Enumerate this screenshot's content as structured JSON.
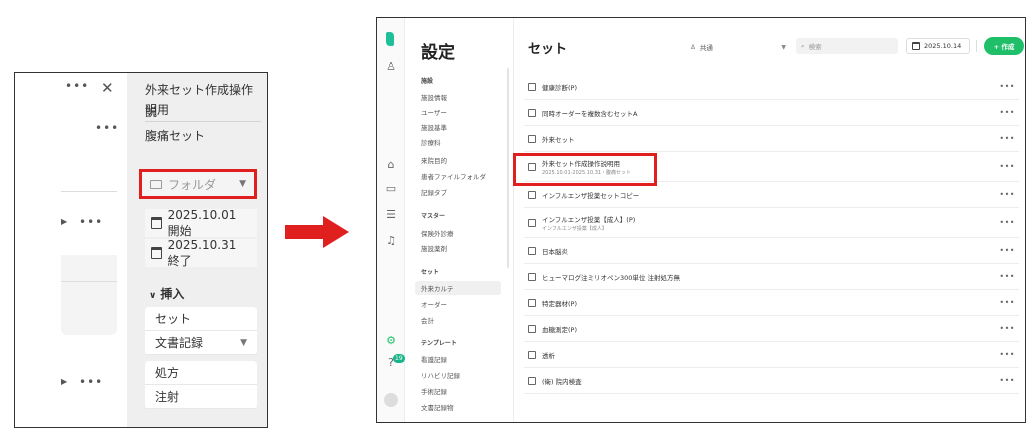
{
  "left_panel": {
    "title_line1": "外来セット作成操作説",
    "title_line2": "明用",
    "subtitle": "腹痛セット",
    "folder_placeholder": "フォルダ",
    "start_date": "2025.10.01 開始",
    "end_date": "2025.10.31 終了",
    "insert_label": "挿入",
    "insert_items": [
      "セット",
      "文書記録"
    ],
    "insert_items2": [
      "処方",
      "注射"
    ]
  },
  "right_panel": {
    "settings_title": "設定",
    "nav": {
      "group1": "施設",
      "group1_items": [
        "施設情報",
        "ユーザー",
        "施設基準",
        "診療科",
        "来院目的",
        "患者ファイルフォルダ",
        "記録タブ"
      ],
      "group2": "マスター",
      "group2_items": [
        "保険外診療",
        "施設薬剤"
      ],
      "group3": "セット",
      "group3_items": [
        "外来カルテ",
        "オーダー",
        "会計"
      ],
      "group4": "テンプレート",
      "group4_items": [
        "看護記録",
        "リハビリ記録",
        "手術記録",
        "文書記録物"
      ]
    },
    "main_title": "セット",
    "share_filter": "共通",
    "search_placeholder": "検索",
    "date_filter": "2025.10.14",
    "create_button": "+ 作成",
    "rows": [
      {
        "name": "健康診断(P)",
        "sub": ""
      },
      {
        "name": "同時オーダーを複数含むセットA",
        "sub": ""
      },
      {
        "name": "外来セット",
        "sub": ""
      },
      {
        "name": "外来セット作成操作説明用",
        "sub": "2025.10.01-2025.10.31・腹痛セット"
      },
      {
        "name": "インフルエンザ投薬セットコピー",
        "sub": ""
      },
      {
        "name": "インフルエンザ投薬【成人】(P)",
        "sub": "インフルエンザ投薬【成人】"
      },
      {
        "name": "日本脳炎",
        "sub": ""
      },
      {
        "name": "ヒューマログ注ミリオペン300単位 注射処方無",
        "sub": ""
      },
      {
        "name": "特定器材(P)",
        "sub": ""
      },
      {
        "name": "血糖測定(P)",
        "sub": ""
      },
      {
        "name": "透析",
        "sub": ""
      },
      {
        "name": "(衛) 院内検査",
        "sub": ""
      }
    ],
    "rail_badge": "19"
  },
  "colors": {
    "highlight": "#e01f1f",
    "accent": "#1fbf6a",
    "arrow": "#e01f1f"
  }
}
